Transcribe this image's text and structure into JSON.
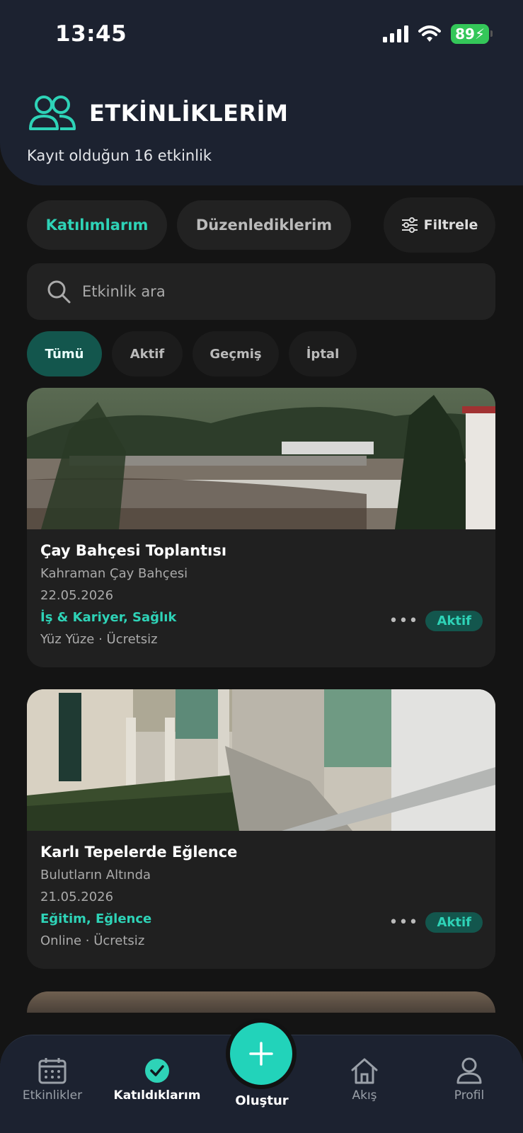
{
  "status": {
    "time": "13:45",
    "battery": "89"
  },
  "header": {
    "title": "ETKİNLİKLERİM",
    "subtitle": "Kayıt olduğun 16 etkinlik"
  },
  "tabs": {
    "participations": "Katılımlarım",
    "organized": "Düzenlediklerim",
    "filter": "Filtrele"
  },
  "search": {
    "placeholder": "Etkinlik ara"
  },
  "chips": [
    "Tümü",
    "Aktif",
    "Geçmiş",
    "İptal"
  ],
  "events": [
    {
      "title": "Çay Bahçesi Toplantısı",
      "location": "Kahraman Çay Bahçesi",
      "date": "22.05.2026",
      "categories": "İş & Kariyer, Sağlık",
      "meta": "Yüz Yüze · Ücretsiz",
      "status": "Aktif"
    },
    {
      "title": "Karlı Tepelerde Eğlence",
      "location": "Bulutların Altında",
      "date": "21.05.2026",
      "categories": "Eğitim, Eğlence",
      "meta": "Online · Ücretsiz",
      "status": "Aktif"
    }
  ],
  "nav": {
    "events": "Etkinlikler",
    "joined": "Katıldıklarım",
    "create": "Oluştur",
    "feed": "Akış",
    "profile": "Profil"
  },
  "colors": {
    "accent": "#2ed3b7",
    "header_bg": "#1c2230",
    "page_bg": "#141414",
    "badge_bg": "#13564d"
  }
}
